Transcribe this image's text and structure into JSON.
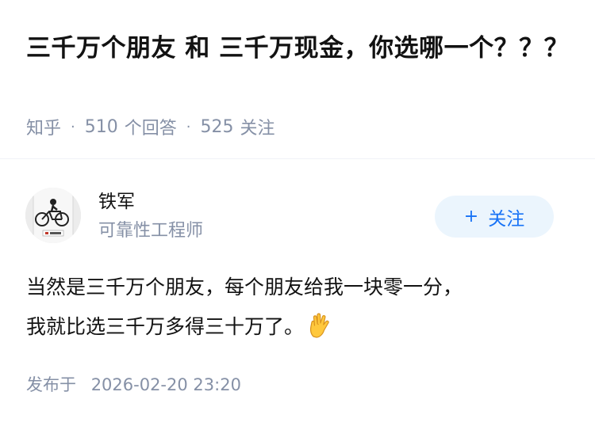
{
  "question": {
    "title": "三千万个朋友 和 三千万现金，你选哪一个？？？",
    "source": "知乎",
    "answer_count": "510",
    "answer_label": "个回答",
    "follow_count": "525",
    "follow_label": "关注"
  },
  "author": {
    "name": "铁军",
    "headline": "可靠性工程师",
    "avatar_icon": "bicycle-avatar",
    "follow_button": {
      "plus": "+",
      "label": "关注"
    }
  },
  "answer": {
    "content_line1": "当然是三千万个朋友，每个朋友给我一块零一分，",
    "content_line2": "我就比选三千万多得三十万了。",
    "emoji_icon": "vulcan-salute-hand-icon",
    "publish_label": "发布于",
    "publish_time": "2026-02-20 23:20"
  },
  "colors": {
    "title": "#121212",
    "meta": "#8590a6",
    "follow_bg": "#ebf5fd",
    "follow_text": "#1772f6"
  }
}
